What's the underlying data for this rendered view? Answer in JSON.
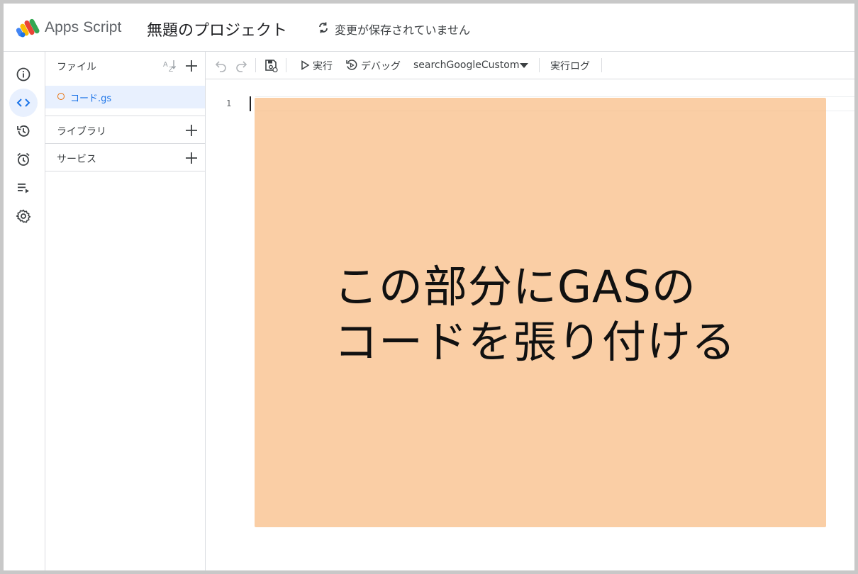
{
  "header": {
    "app_name": "Apps Script",
    "project_title": "無題のプロジェクト",
    "save_status": "変更が保存されていません"
  },
  "rail": {
    "items": [
      {
        "name": "overview",
        "icon": "info-icon",
        "active": false
      },
      {
        "name": "editor",
        "icon": "code-icon",
        "active": true
      },
      {
        "name": "history",
        "icon": "history-icon",
        "active": false
      },
      {
        "name": "triggers",
        "icon": "alarm-icon",
        "active": false
      },
      {
        "name": "executions",
        "icon": "playlist-icon",
        "active": false
      },
      {
        "name": "settings",
        "icon": "gear-icon",
        "active": false
      }
    ]
  },
  "files_panel": {
    "files_label": "ファイル",
    "sort_label": "AZ",
    "files": [
      {
        "name": "コード.gs",
        "unsaved": true
      }
    ],
    "libraries_label": "ライブラリ",
    "services_label": "サービス"
  },
  "toolbar": {
    "run_label": "実行",
    "debug_label": "デバッグ",
    "function_name": "searchGoogleCustom",
    "log_label": "実行ログ"
  },
  "editor": {
    "line_numbers": [
      "1"
    ]
  },
  "overlay": {
    "line1": "この部分にGASの",
    "line2": "コードを張り付ける"
  },
  "colors": {
    "accent": "#1a73e8",
    "active_bg": "#e8f0fe",
    "unsaved_dot": "#e8710a",
    "overlay": "#f8bb82"
  }
}
